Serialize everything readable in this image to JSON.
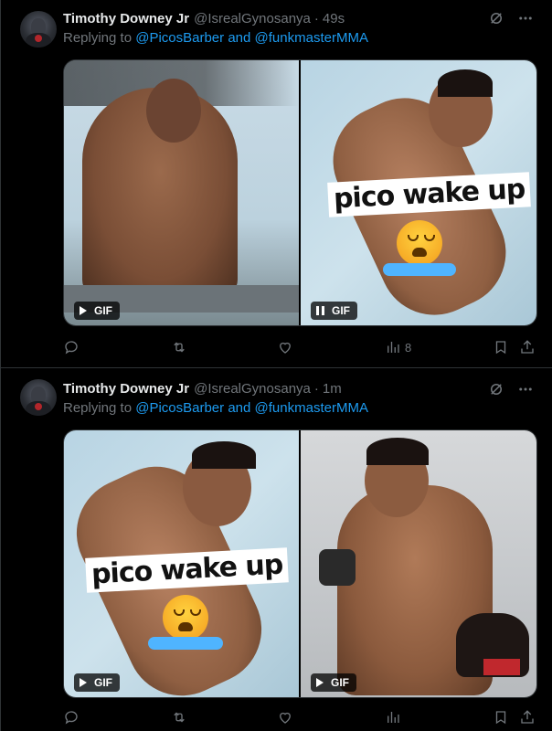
{
  "tweets": [
    {
      "author": "Timothy Downey Jr",
      "handle": "@IsrealGynosanya",
      "separator": "·",
      "time": "49s",
      "replying_prefix": "Replying to",
      "replying_user1": "@PicosBarber",
      "replying_and": "and",
      "replying_user2": "@funkmasterMMA",
      "media": [
        {
          "badge": "GIF",
          "state": "play"
        },
        {
          "badge": "GIF",
          "state": "pause",
          "caption": "pico wake up"
        }
      ],
      "views": "8"
    },
    {
      "author": "Timothy Downey Jr",
      "handle": "@IsrealGynosanya",
      "separator": "·",
      "time": "1m",
      "replying_prefix": "Replying to",
      "replying_user1": "@PicosBarber",
      "replying_and": "and",
      "replying_user2": "@funkmasterMMA",
      "media": [
        {
          "badge": "GIF",
          "state": "play",
          "caption": "pico wake up"
        },
        {
          "badge": "GIF",
          "state": "play"
        }
      ],
      "views": ""
    }
  ],
  "icons": {
    "grok": "grok-icon",
    "more": "more-icon",
    "reply": "reply-icon",
    "retweet": "retweet-icon",
    "like": "like-icon",
    "views": "views-icon",
    "bookmark": "bookmark-icon",
    "share": "share-icon"
  },
  "colors": {
    "link": "#1d9bf0",
    "muted": "#71767b",
    "text": "#e7e9ea",
    "border": "#2f3336"
  }
}
